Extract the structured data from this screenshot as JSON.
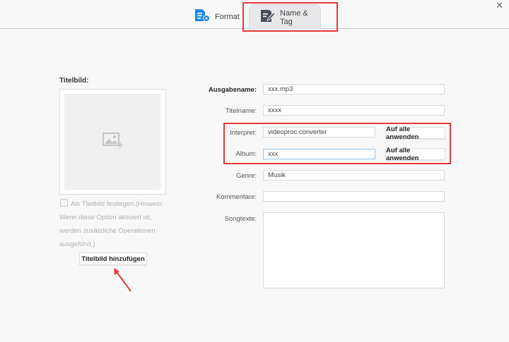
{
  "tabs": [
    {
      "label": "Format",
      "icon": "format-settings-icon"
    },
    {
      "label": "Name & Tag",
      "icon": "edit-tag-icon",
      "active": true
    }
  ],
  "left": {
    "title": "Titelbild:",
    "image_placeholder_icon": "add-image-icon",
    "checkbox_label": "Als Titelbild festlegen.(Hinweis: Wenn diese Option aktiviert ist, werden zusätzliche Operationen ausgeführt.)",
    "add_button": "Titelbild hinzufügen"
  },
  "fields": {
    "ausgabename": {
      "label": "Ausgabename:",
      "value": "xxx.mp3"
    },
    "titelname": {
      "label": "Titelname:",
      "value": "xxxx"
    },
    "interpret": {
      "label": "Interpret:",
      "value": "videoproc converter",
      "apply": "Auf alle anwenden"
    },
    "album": {
      "label": "Album:",
      "value": "xxx",
      "apply": "Auf alle anwenden"
    },
    "genre": {
      "label": "Genre:",
      "value": "Musik"
    },
    "kommentare": {
      "label": "Kommentare:",
      "value": ""
    },
    "songtexte": {
      "label": "Songtexte:",
      "value": ""
    }
  },
  "colors": {
    "highlight": "#e53a3a",
    "accent": "#1e88e5"
  }
}
